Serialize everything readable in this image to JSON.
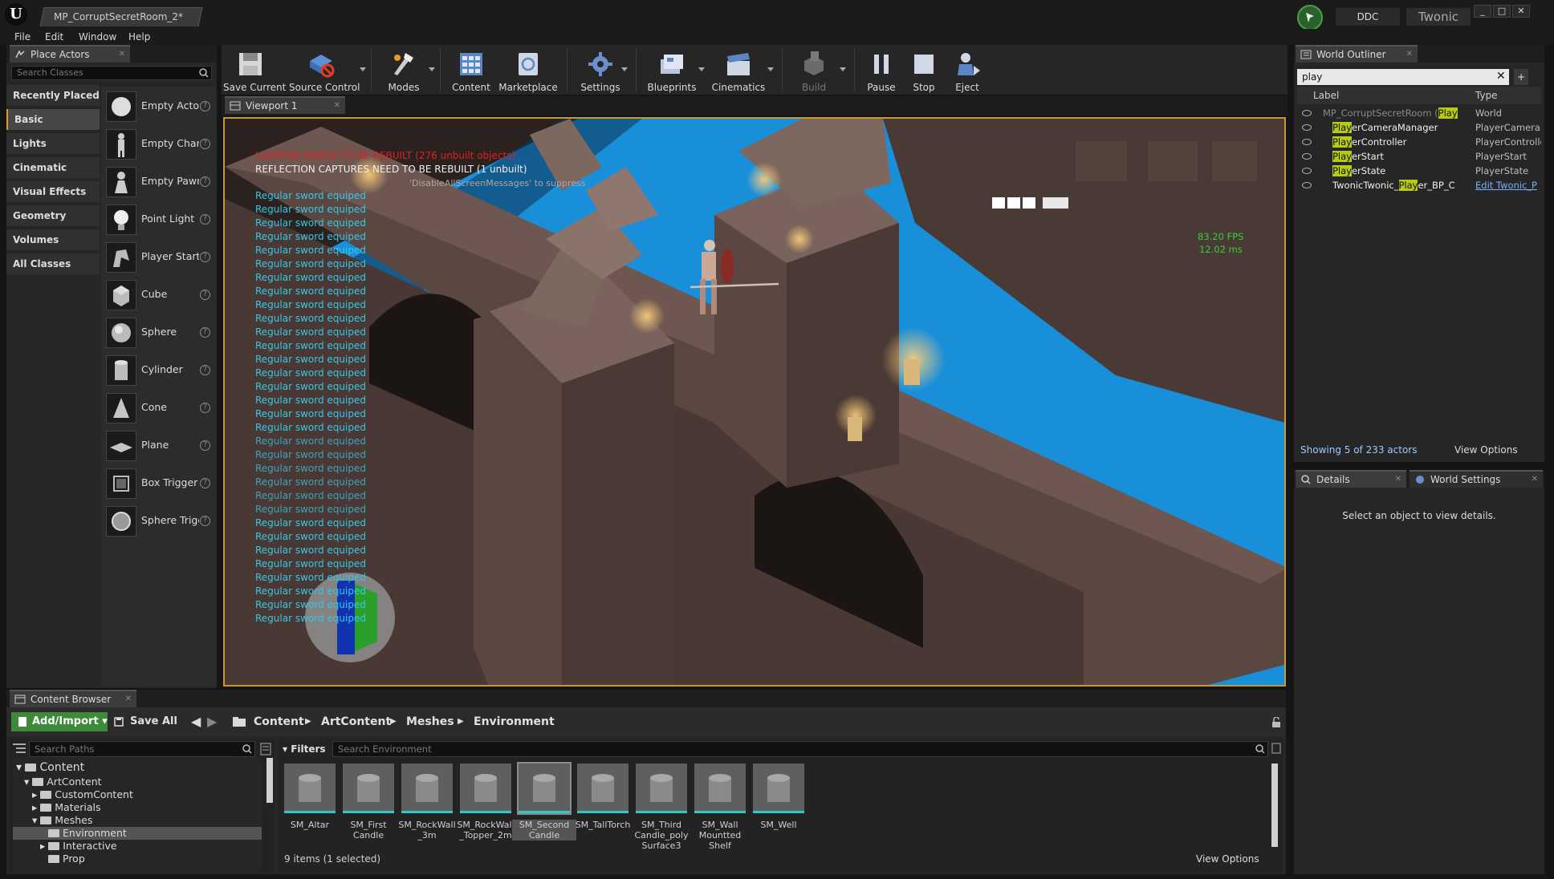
{
  "title_bar": {
    "document_tab": "MP_CorruptSecretRoom_2*",
    "ddc_label": "DDC",
    "project_name": "Twonic"
  },
  "menu": [
    "File",
    "Edit",
    "Window",
    "Help"
  ],
  "place_actors": {
    "tab_label": "Place Actors",
    "search_placeholder": "Search Classes",
    "categories": [
      "Recently Placed",
      "Basic",
      "Lights",
      "Cinematic",
      "Visual Effects",
      "Geometry",
      "Volumes",
      "All Classes"
    ],
    "selected_category": "Basic",
    "actors": [
      "Empty Actor",
      "Empty Character",
      "Empty Pawn",
      "Point Light",
      "Player Start",
      "Cube",
      "Sphere",
      "Cylinder",
      "Cone",
      "Plane",
      "Box Trigger",
      "Sphere Trigger"
    ]
  },
  "toolbar": {
    "buttons": [
      "Save Current",
      "Source Control",
      "Modes",
      "Content",
      "Marketplace",
      "Settings",
      "Blueprints",
      "Cinematics",
      "Build",
      "Pause",
      "Stop",
      "Eject"
    ]
  },
  "viewport": {
    "tab_label": "Viewport 1",
    "lighting_warning": "LIGHTING NEEDS TO BE REBUILT (276 unbuilt objects)",
    "reflection_warning": "REFLECTION CAPTURES NEED TO BE REBUILT (1 unbuilt)",
    "suppress_hint": "'DisableAllScreenMessages' to suppress",
    "debug_message": "Regular sword equiped",
    "fps": "83.20 FPS",
    "ms": "12.02 ms",
    "accent_color": "#c89a2e",
    "message_color": "#35c8e8",
    "warning_color": "#e02020",
    "stats_color": "#35d035"
  },
  "world_outliner": {
    "tab_label": "World Outliner",
    "search_value": "play",
    "col_label": "Label",
    "col_type": "Type",
    "rows": [
      {
        "label": "MP_CorruptSecretRoom (Play",
        "highlight": "",
        "type": "World"
      },
      {
        "label": "PlayerCameraManager",
        "highlight": "Play",
        "type": "PlayerCameraM"
      },
      {
        "label": "PlayerController",
        "highlight": "Play",
        "type": "PlayerControlle"
      },
      {
        "label": "PlayerStart",
        "highlight": "Play",
        "type": "PlayerStart"
      },
      {
        "label": "PlayerState",
        "highlight": "Play",
        "type": "PlayerState"
      },
      {
        "label": "TwonicTwonic_Player_BP_C",
        "highlight": "",
        "type": "Edit Twonic_P"
      }
    ],
    "status": "Showing 5 of 233 actors",
    "view_options": "View Options"
  },
  "details": {
    "tab_label": "Details",
    "world_settings_tab": "World Settings",
    "empty_text": "Select an object to view details."
  },
  "content_browser": {
    "tab_label": "Content Browser",
    "add_import": "Add/Import",
    "save_all": "Save All",
    "breadcrumb": [
      "Content",
      "ArtContent",
      "Meshes",
      "Environment"
    ],
    "search_paths_placeholder": "Search Paths",
    "filters_label": "Filters",
    "search_assets_placeholder": "Search Environment",
    "tree": [
      {
        "name": "Content",
        "depth": 0
      },
      {
        "name": "ArtContent",
        "depth": 1
      },
      {
        "name": "CustomContent",
        "depth": 2
      },
      {
        "name": "Materials",
        "depth": 2
      },
      {
        "name": "Meshes",
        "depth": 2
      },
      {
        "name": "Environment",
        "depth": 3
      },
      {
        "name": "Interactive",
        "depth": 3
      },
      {
        "name": "Prop",
        "depth": 3
      }
    ],
    "selected_folder": "Environment",
    "assets": [
      "SM_Altar",
      "SM_First Candle",
      "SM_RockWall _3m",
      "SM_RockWall _Topper_2m",
      "SM_Second Candle",
      "SM_TallTorch",
      "SM_Third Candle_poly Surface3",
      "SM_Wall Mountted Shelf",
      "SM_Well"
    ],
    "selected_asset": "SM_Second Candle",
    "item_count": "9 items (1 selected)",
    "view_options": "View Options"
  }
}
